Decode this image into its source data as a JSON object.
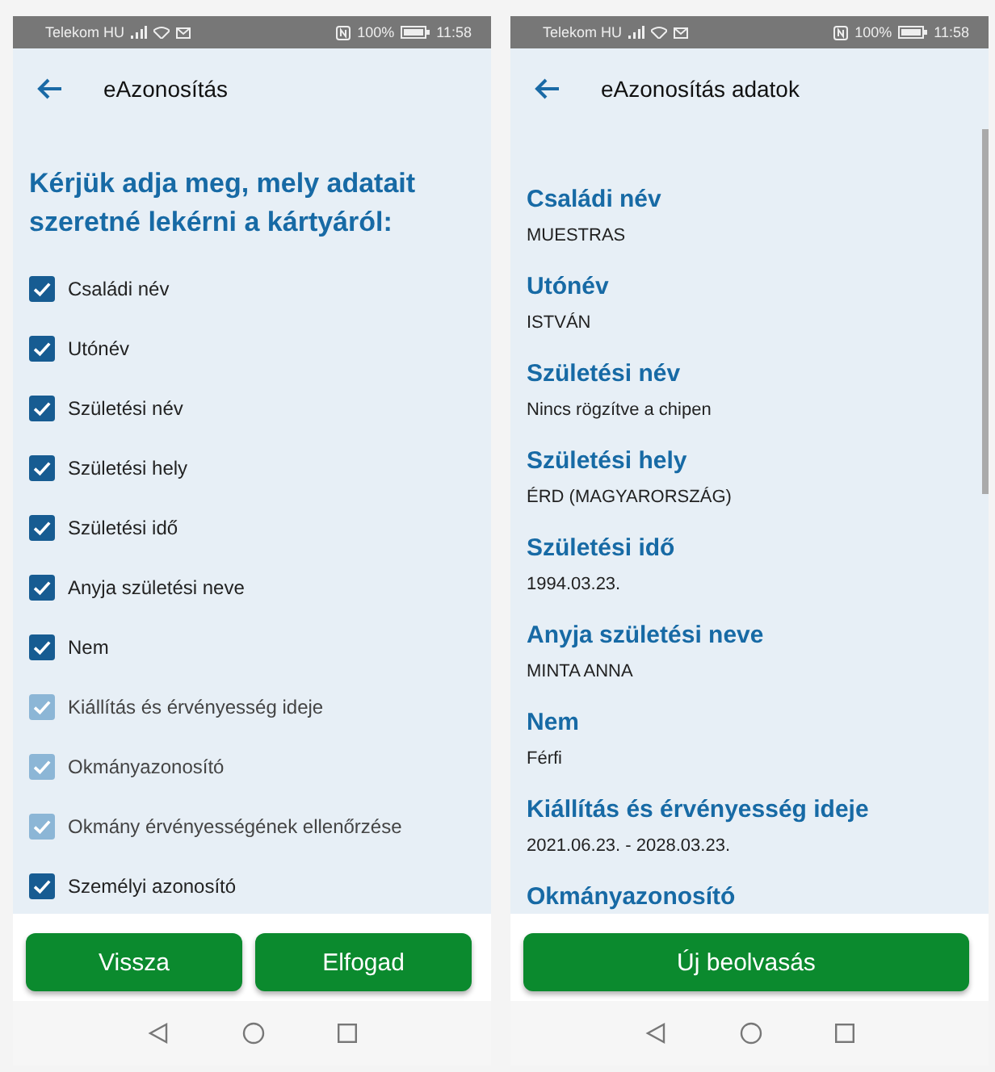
{
  "screens": [
    {
      "kind": "checklist",
      "status_bar": {
        "carrier": "Telekom HU",
        "battery": "100%",
        "time": "11:58"
      },
      "title": "eAzonosítás",
      "heading": "Kérjük adja meg, mely adatait szeretné lekérni a kártyáról:",
      "items": [
        {
          "label": "Családi név",
          "checked": true,
          "disabled": false
        },
        {
          "label": "Utónév",
          "checked": true,
          "disabled": false
        },
        {
          "label": "Születési név",
          "checked": true,
          "disabled": false
        },
        {
          "label": "Születési hely",
          "checked": true,
          "disabled": false
        },
        {
          "label": "Születési idő",
          "checked": true,
          "disabled": false
        },
        {
          "label": "Anyja születési neve",
          "checked": true,
          "disabled": false
        },
        {
          "label": "Nem",
          "checked": true,
          "disabled": false
        },
        {
          "label": "Kiállítás és érvényesség ideje",
          "checked": true,
          "disabled": true
        },
        {
          "label": "Okmányazonosító",
          "checked": true,
          "disabled": true
        },
        {
          "label": "Okmány érvényességének ellenőrzése",
          "checked": true,
          "disabled": true
        },
        {
          "label": "Személyi azonosító",
          "checked": true,
          "disabled": false
        }
      ],
      "buttons": [
        "Vissza",
        "Elfogad"
      ]
    },
    {
      "kind": "details",
      "status_bar": {
        "carrier": "Telekom HU",
        "battery": "100%",
        "time": "11:58"
      },
      "title": "eAzonosítás adatok",
      "fields": [
        {
          "label": "Családi név",
          "value": "MUESTRAS"
        },
        {
          "label": "Utónév",
          "value": "ISTVÁN"
        },
        {
          "label": "Születési név",
          "value": "Nincs rögzítve a chipen"
        },
        {
          "label": "Születési hely",
          "value": "ÉRD (MAGYARORSZÁG)"
        },
        {
          "label": "Születési idő",
          "value": "1994.03.23."
        },
        {
          "label": "Anyja születési neve",
          "value": "MINTA ANNA"
        },
        {
          "label": "Nem",
          "value": "Férfi"
        },
        {
          "label": "Kiállítás és érvényesség ideje",
          "value": "2021.06.23. - 2028.03.23."
        },
        {
          "label": "Okmányazonosító"
        }
      ],
      "buttons": [
        "Új beolvasás"
      ]
    }
  ]
}
